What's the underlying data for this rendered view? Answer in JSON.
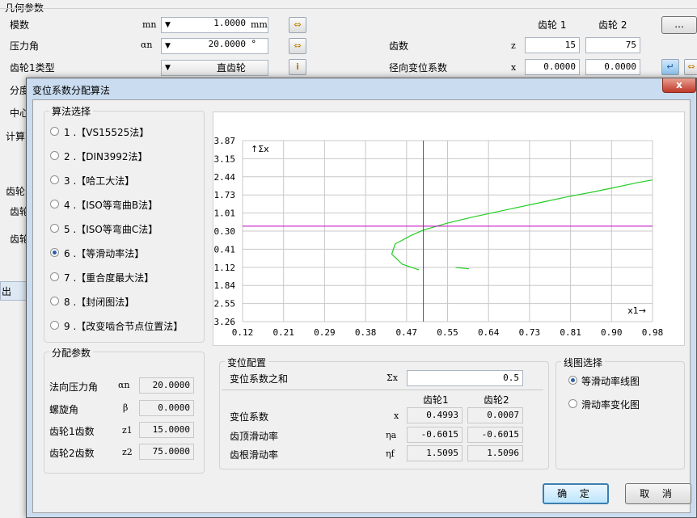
{
  "background": {
    "section_title": "几何参数",
    "rows": [
      {
        "label": "模数",
        "symbol": "mn",
        "value": "1.0000",
        "unit": "mm"
      },
      {
        "label": "压力角",
        "symbol": "αn",
        "value": "20.0000",
        "unit": "°"
      },
      {
        "label": "齿轮1类型",
        "value": "直齿轮"
      }
    ],
    "gear_headers": [
      "齿轮 1",
      "齿轮 2"
    ],
    "more_button": "...",
    "teeth": {
      "label": "齿数",
      "symbol": "z",
      "values": [
        "15",
        "75"
      ]
    },
    "shift": {
      "label": "径向变位系数",
      "symbol": "x",
      "values": [
        "0.0000",
        "0.0000"
      ]
    },
    "partial_labels": [
      "分度",
      "中心",
      "计算",
      "齿轮",
      "齿轮",
      "齿轮",
      "出"
    ]
  },
  "dialog": {
    "title": "变位系数分配算法",
    "close_label": "x",
    "algo_group": {
      "title": "算法选择",
      "options": [
        "1 .【VS15525法】",
        "2 .【DIN3992法】",
        "3 .【哈工大法】",
        "4 .【ISO等弯曲B法】",
        "5 .【ISO等弯曲C法】",
        "6 .【等滑动率法】",
        "7 .【重合度最大法】",
        "8 .【封闭图法】",
        "9 .【改变啮合节点位置法】"
      ],
      "selected": 5
    },
    "params_group": {
      "title": "分配参数",
      "rows": [
        {
          "label": "法向压力角",
          "symbol": "αn",
          "value": "20.0000"
        },
        {
          "label": "螺旋角",
          "symbol": "β",
          "value": "0.0000"
        },
        {
          "label": "齿轮1齿数",
          "symbol": "z1",
          "value": "15.0000"
        },
        {
          "label": "齿轮2齿数",
          "symbol": "z2",
          "value": "75.0000"
        }
      ]
    },
    "config_group": {
      "title": "变位配置",
      "sum_label": "变位系数之和",
      "sum_symbol": "Σx",
      "sum_value": "0.5",
      "col_headers": [
        "齿轮1",
        "齿轮2"
      ],
      "rows": [
        {
          "label": "变位系数",
          "symbol": "x",
          "values": [
            "0.4993",
            "0.0007"
          ]
        },
        {
          "label": "齿顶滑动率",
          "symbol": "ηa",
          "values": [
            "-0.6015",
            "-0.6015"
          ]
        },
        {
          "label": "齿根滑动率",
          "symbol": "ηf",
          "values": [
            "1.5095",
            "1.5096"
          ]
        }
      ]
    },
    "chart_select_group": {
      "title": "线图选择",
      "options": [
        "等滑动率线图",
        "滑动率变化图"
      ],
      "selected": 0
    },
    "ok_button": "确 定",
    "cancel_button": "取 消"
  },
  "chart_data": {
    "type": "line",
    "y_axis_label": "↑Σx",
    "x_axis_label": "x1→",
    "x_ticks": [
      "0.12",
      "0.21",
      "0.29",
      "0.38",
      "0.47",
      "0.55",
      "0.64",
      "0.73",
      "0.81",
      "0.90",
      "0.98"
    ],
    "y_ticks": [
      "3.87",
      "3.15",
      "2.44",
      "1.73",
      "1.01",
      "0.30",
      "-0.41",
      "-1.12",
      "-1.84",
      "-2.55",
      "-3.26"
    ],
    "xlim": [
      0.12,
      0.98
    ],
    "ylim": [
      -3.26,
      3.87
    ],
    "grid": true,
    "cursor": {
      "x": 0.4993,
      "y": 0.5,
      "color": "#c000c0"
    },
    "series": [
      {
        "color": "#22cc22",
        "points": [
          [
            0.49,
            -1.22
          ],
          [
            0.455,
            -1.0
          ],
          [
            0.433,
            -0.6
          ],
          [
            0.44,
            -0.2
          ],
          [
            0.475,
            0.15
          ],
          [
            0.5,
            0.35
          ],
          [
            0.55,
            0.62
          ],
          [
            0.6,
            0.85
          ],
          [
            0.65,
            1.05
          ],
          [
            0.7,
            1.25
          ],
          [
            0.75,
            1.45
          ],
          [
            0.8,
            1.65
          ],
          [
            0.85,
            1.83
          ],
          [
            0.9,
            2.02
          ],
          [
            0.95,
            2.22
          ],
          [
            0.98,
            2.32
          ]
        ]
      },
      {
        "color": "#22cc22",
        "points": [
          [
            0.567,
            -1.12
          ],
          [
            0.578,
            -1.15
          ],
          [
            0.595,
            -1.18
          ]
        ]
      }
    ]
  }
}
